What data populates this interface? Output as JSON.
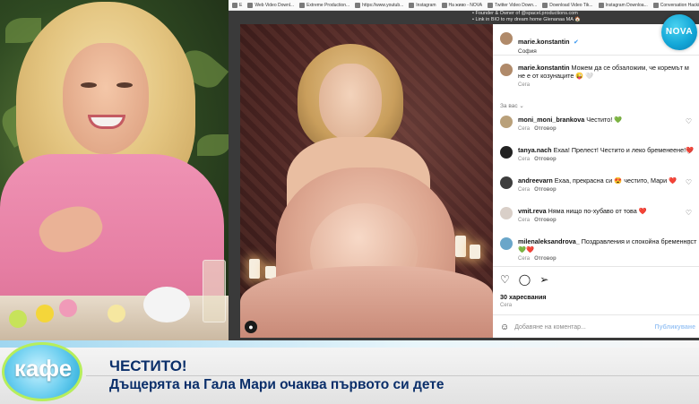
{
  "bookmarks": [
    {
      "label": "E"
    },
    {
      "label": "Web Video Downl..."
    },
    {
      "label": "Extreme Production..."
    },
    {
      "label": "https://www.youtub..."
    },
    {
      "label": "Instagram"
    },
    {
      "label": "На живо - NOVA"
    },
    {
      "label": "Twitter Video Down..."
    },
    {
      "label": "Download Video Tik..."
    },
    {
      "label": "Instagram Downloa..."
    },
    {
      "label": "Conversation Hacki..."
    },
    {
      "label": "Faceb"
    }
  ],
  "background_page": {
    "line1": "• Founder & Owner of @spacel.productions.com",
    "line2": "• Link in BIO to my dream home Glenanaa MA 🏠"
  },
  "post": {
    "author": "marie.konstantin",
    "location": "София",
    "caption": "Можем да се обзаложим, че коремът м",
    "caption_line2": "не е от козунаците 😜 🤍",
    "caption_time": "Сега",
    "for_you_label": "За вас ⌄"
  },
  "comments": [
    {
      "user": "moni_moni_brankova",
      "text": "Честито! 💚",
      "time": "Сега",
      "reply": "Отговор",
      "avatar_color": "#b9a07a"
    },
    {
      "user": "tanya.nach",
      "text": "Ехаа! Прелест! Честито и леко бременеене!❤️",
      "time": "Сега",
      "reply": "Отговор",
      "avatar_color": "#222222"
    },
    {
      "user": "andreevarn",
      "text": "Ехаа, прекрасна си 😍 честито, Мари ❤️",
      "time": "Сега",
      "reply": "Отговор",
      "avatar_color": "#3d3d3d"
    },
    {
      "user": "vmit.reva",
      "text": "Няма нищо по-хубаво от това ❤️",
      "time": "Сега",
      "reply": "Отговор",
      "avatar_color": "#d9cfc8"
    },
    {
      "user": "milenaleksandrova_",
      "text": "Поздравления и спокойна бременност",
      "text2": "💚❤️",
      "time": "Сега",
      "reply": "Отговор",
      "avatar_color": "#6aa6c9"
    }
  ],
  "actions": {
    "like_icon": "heart-outline-icon",
    "comment_icon": "comment-bubble-icon",
    "share_icon": "send-icon"
  },
  "likes_text": "30 харесвания",
  "post_time": "Сега",
  "comment_placeholder": "Добавяне на коментар...",
  "post_button": "Публикуване",
  "channel_logo": "NOVA",
  "show_logo": "кафе",
  "lower_third": {
    "title": "ЧЕСТИТО!",
    "subtitle": "Дъщерята на Гала Мари очаква първото си дете"
  },
  "colors": {
    "headline": "#0b2f6a",
    "nova_blue": "#14a8d8",
    "kafe_ring": "#b6ee5c"
  }
}
